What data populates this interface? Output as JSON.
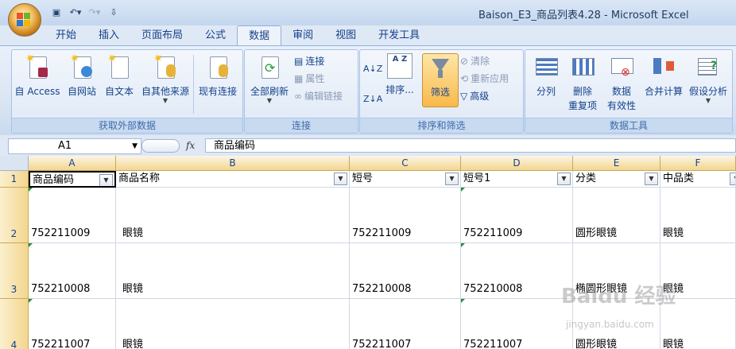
{
  "window": {
    "title": "Baison_E3_商品列表4.28 - Microsoft Excel"
  },
  "tabs": [
    "开始",
    "插入",
    "页面布局",
    "公式",
    "数据",
    "审阅",
    "视图",
    "开发工具"
  ],
  "active_tab": "数据",
  "ribbon": {
    "get_external": {
      "label": "获取外部数据",
      "buttons": [
        "自 Access",
        "自网站",
        "自文本",
        "自其他来源",
        "现有连接"
      ]
    },
    "connections": {
      "label": "连接",
      "refresh_all": "全部刷新",
      "connections": "连接",
      "properties": "属性",
      "edit_links": "编辑链接"
    },
    "sort_filter": {
      "label": "排序和筛选",
      "sort_az": "A Z",
      "sort": "排序...",
      "filter": "筛选",
      "clear": "清除",
      "reapply": "重新应用",
      "advanced": "高级"
    },
    "data_tools": {
      "label": "数据工具",
      "text_to_columns": "分列",
      "remove_duplicates_1": "删除",
      "remove_duplicates_2": "重复项",
      "validation_1": "数据",
      "validation_2": "有效性",
      "consolidate": "合并计算",
      "what_if": "假设分析"
    }
  },
  "formula_bar": {
    "name_box": "A1",
    "fx": "fx",
    "value": "商品编码"
  },
  "grid": {
    "columns": [
      "A",
      "B",
      "C",
      "D",
      "E",
      "F"
    ],
    "headers": [
      "商品编码",
      "商品名称",
      "短号",
      "短号1",
      "分类",
      "中品类"
    ],
    "rows": [
      {
        "num": "1"
      },
      {
        "num": "2",
        "cells": [
          "752211009",
          "眼镜",
          "752211009",
          "752211009",
          "圆形眼镜",
          "眼镜"
        ]
      },
      {
        "num": "3",
        "cells": [
          "752210008",
          "眼镜",
          "752210008",
          "752210008",
          "椭圆形眼镜",
          "眼镜"
        ]
      },
      {
        "num": "4",
        "cells": [
          "752211007",
          "眼镜",
          "752211007",
          "752211007",
          "圆形眼镜",
          "眼镜"
        ]
      }
    ]
  },
  "watermark": {
    "logo": "Baidu 经验",
    "url": "jingyan.baidu.com"
  },
  "colors": {
    "ribbon": "#dfe8f5",
    "header_highlight": "#f3d68f",
    "active_filter": "#f9b94a"
  }
}
